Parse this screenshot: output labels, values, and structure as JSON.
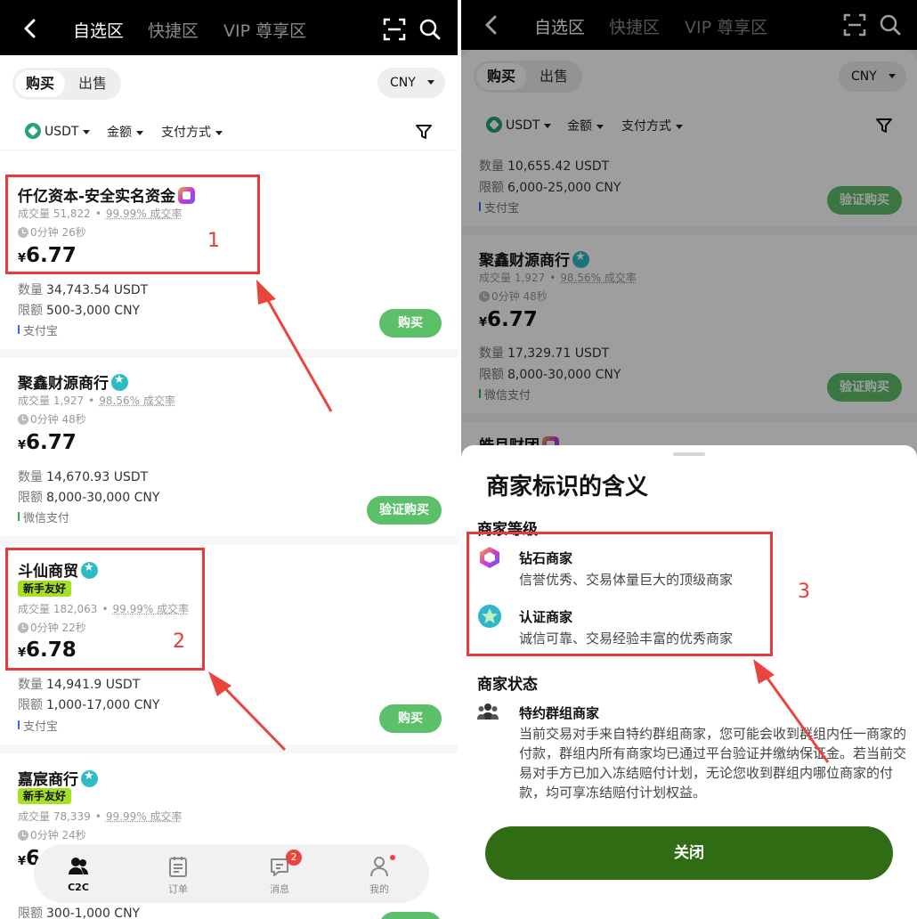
{
  "nav": {
    "tabs": [
      "自选区",
      "快捷区",
      "VIP 尊享区"
    ]
  },
  "trade": {
    "buy_label": "购买",
    "sell_label": "出售",
    "currency": "CNY"
  },
  "filters": {
    "coin": "USDT",
    "amount": "金额",
    "payment": "支付方式"
  },
  "listings": [
    {
      "merchant": "仟亿资本-安全实名资金",
      "badge": "diamond",
      "trades": "成交量 51,822",
      "rate": "99.99% 成交率",
      "time": "0分钟 26秒",
      "currency_symbol": "¥",
      "price": "6.77",
      "quantity_label": "数量",
      "quantity": "34,743.54 USDT",
      "limit_label": "限额",
      "limit": "500-3,000 CNY",
      "payment": "支付宝",
      "action": "购买"
    },
    {
      "merchant": "聚鑫财源商行",
      "badge": "cert",
      "trades": "成交量 1,927",
      "rate": "98.56% 成交率",
      "time": "0分钟 48秒",
      "currency_symbol": "¥",
      "price": "6.77",
      "quantity_label": "数量",
      "quantity": "14,670.93 USDT",
      "limit_label": "限额",
      "limit": "8,000-30,000 CNY",
      "payment": "微信支付",
      "action": "验证购买"
    },
    {
      "merchant": "斗仙商贸",
      "badge": "cert",
      "tag": "新手友好",
      "trades": "成交量 182,063",
      "rate": "99.99% 成交率",
      "time": "0分钟 22秒",
      "currency_symbol": "¥",
      "price": "6.78",
      "quantity_label": "数量",
      "quantity": "14,941.9 USDT",
      "limit_label": "限额",
      "limit": "1,000-17,000 CNY",
      "payment": "支付宝",
      "action": "购买"
    },
    {
      "merchant": "嘉宸商行",
      "badge": "cert",
      "tag": "新手友好",
      "trades": "成交量 78,339",
      "rate": "99.99% 成交率",
      "time": "0分钟 24秒",
      "currency_symbol": "¥",
      "price": "6",
      "limit_label": "限额",
      "limit": "300-1,000 CNY"
    }
  ],
  "right_listings": [
    {
      "quantity_label": "数量",
      "quantity": "10,655.42 USDT",
      "limit_label": "限额",
      "limit": "6,000-25,000 CNY",
      "payment": "支付宝",
      "action": "验证购买"
    },
    {
      "merchant": "聚鑫财源商行",
      "badge": "cert",
      "trades": "成交量 1,927",
      "rate": "98.56% 成交率",
      "time": "0分钟 48秒",
      "currency_symbol": "¥",
      "price": "6.77",
      "quantity_label": "数量",
      "quantity": "17,329.71 USDT",
      "limit_label": "限额",
      "limit": "8,000-30,000 CNY",
      "payment": "微信支付",
      "action": "验证购买"
    },
    {
      "merchant": "皓月财团",
      "badge": "diamond"
    }
  ],
  "tabbar": [
    {
      "label": "C2C",
      "active": true
    },
    {
      "label": "订单"
    },
    {
      "label": "消息",
      "badge": "2"
    },
    {
      "label": "我的",
      "dot": true
    }
  ],
  "modal": {
    "title": "商家标识的含义",
    "level_section": "商家等级",
    "diamond_name": "钻石商家",
    "diamond_desc": "信誉优秀、交易体量巨大的顶级商家",
    "cert_name": "认证商家",
    "cert_desc": "诚信可靠、交易经验丰富的优秀商家",
    "status_section": "商家状态",
    "group_name": "特约群组商家",
    "group_desc": "当前交易对手来自特约群组商家，您可能会收到群组内任一商家的付款，群组内所有商家均已通过平台验证并缴纳保证金。若当前交易对手方已加入冻结赔付计划，无论您收到群组内哪位商家的付款，均可享冻结赔付计划权益。",
    "close": "关闭"
  },
  "annotations": [
    "1",
    "2",
    "3"
  ],
  "colors": {
    "buy_button": "#5cbf6a",
    "close_button": "#2f6c14",
    "annotation_red": "#e83a3a",
    "newbie_tag": "#a6e022"
  }
}
